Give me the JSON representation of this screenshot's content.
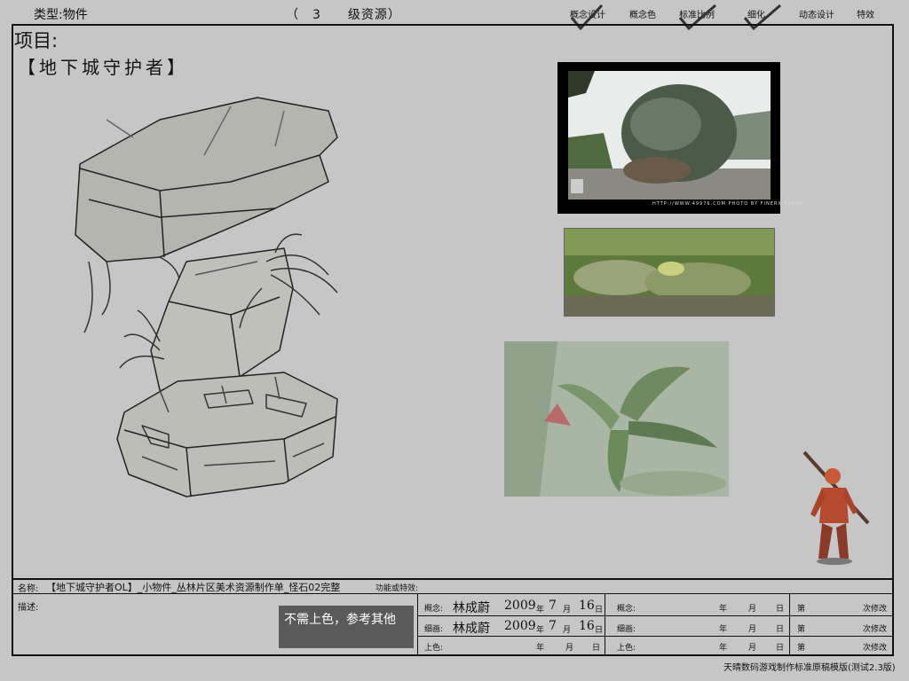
{
  "header": {
    "type_label": "类型:",
    "type_value": "物件",
    "grade_text": "（　3　　级资源）",
    "nav": [
      "概念设计",
      "概念色",
      "标准比例",
      "细化",
      "动态设计",
      "特效"
    ],
    "checked": [
      "概念设计",
      "标准比例",
      "细化"
    ]
  },
  "project": {
    "label": "项目:",
    "name": "【地下城守护者】"
  },
  "reference": {
    "caption": "HTTP://WWW.49976.COM PHOTO BY FINERX 55000"
  },
  "form": {
    "name_label": "名称:",
    "name_value": "【地下城守护者OL】_小物件_丛林片区美术资源制作单_怪石02完整",
    "func_label": "功能或特效:",
    "desc_label": "描述:",
    "note": "不需上色，参考其他",
    "col1": [
      {
        "label": "概念:",
        "author": "林成蔚",
        "year": "2009",
        "y": "年",
        "month": "7",
        "m": "月",
        "day": "16",
        "d": "日"
      },
      {
        "label": "细画:",
        "author": "林成蔚",
        "year": "2009",
        "y": "年",
        "month": "7",
        "m": "月",
        "day": "16",
        "d": "日"
      },
      {
        "label": "上色:",
        "y": "年",
        "m": "月",
        "d": "日"
      }
    ],
    "col2": [
      {
        "label": "概念:",
        "y": "年",
        "m": "月",
        "d": "日"
      },
      {
        "label": "细画:",
        "y": "年",
        "m": "月",
        "d": "日"
      },
      {
        "label": "上色:",
        "y": "年",
        "m": "月",
        "d": "日"
      }
    ],
    "col3": [
      {
        "pre": "第",
        "post": "次修改"
      },
      {
        "pre": "第",
        "post": "次修改"
      },
      {
        "pre": "第",
        "post": "次修改"
      }
    ]
  },
  "footer": "天晴数码游戏制作标准原稿模版(测试2.3版)"
}
